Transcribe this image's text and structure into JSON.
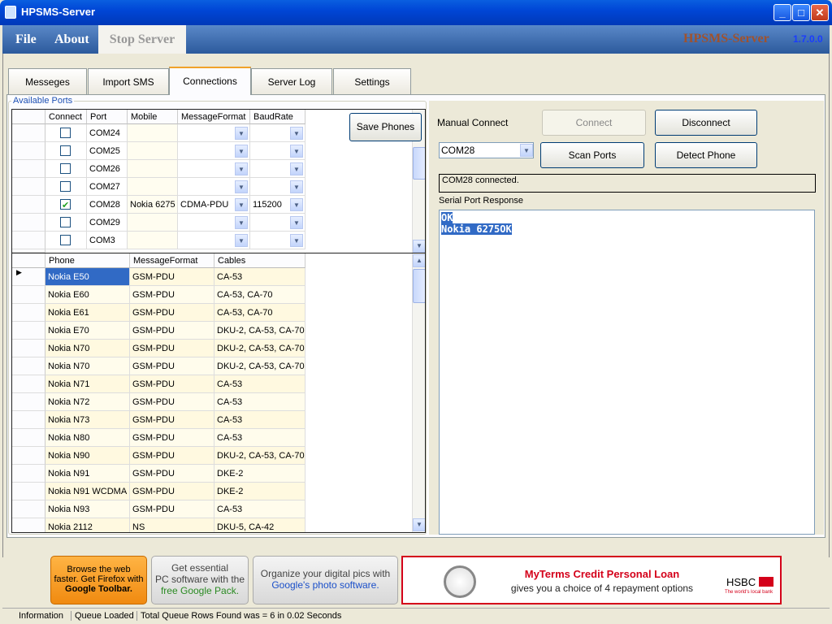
{
  "window": {
    "title": "HPSMS-Server"
  },
  "menu": {
    "file": "File",
    "about": "About",
    "stop": "Stop Server",
    "brand": "HPSMS-Server",
    "version": "1.7.0.0"
  },
  "tabs": [
    "Messeges",
    "Import SMS",
    "Connections",
    "Server Log",
    "Settings"
  ],
  "active_tab": "Connections",
  "ports": {
    "group_label": "Available Ports",
    "columns": [
      "Connect",
      "Port",
      "Mobile",
      "MessageFormat",
      "BaudRate"
    ],
    "rows": [
      {
        "checked": false,
        "port": "COM24",
        "mobile": "",
        "format": "",
        "baud": ""
      },
      {
        "checked": false,
        "port": "COM25",
        "mobile": "",
        "format": "",
        "baud": ""
      },
      {
        "checked": false,
        "port": "COM26",
        "mobile": "",
        "format": "",
        "baud": ""
      },
      {
        "checked": false,
        "port": "COM27",
        "mobile": "",
        "format": "",
        "baud": ""
      },
      {
        "checked": true,
        "port": "COM28",
        "mobile": "Nokia 6275",
        "format": "CDMA-PDU",
        "baud": "115200"
      },
      {
        "checked": false,
        "port": "COM29",
        "mobile": "",
        "format": "",
        "baud": ""
      },
      {
        "checked": false,
        "port": "COM3",
        "mobile": "",
        "format": "",
        "baud": ""
      }
    ],
    "save_label": "Save Phones"
  },
  "phones": {
    "columns": [
      "Phone",
      "MessageFormat",
      "Cables"
    ],
    "rows": [
      [
        "Nokia E50",
        "GSM-PDU",
        "CA-53"
      ],
      [
        "Nokia E60",
        "GSM-PDU",
        "CA-53, CA-70"
      ],
      [
        "Nokia E61",
        "GSM-PDU",
        "CA-53, CA-70"
      ],
      [
        "Nokia E70",
        "GSM-PDU",
        "DKU-2, CA-53, CA-70"
      ],
      [
        "Nokia N70",
        "GSM-PDU",
        "DKU-2, CA-53, CA-70"
      ],
      [
        "Nokia N70",
        "GSM-PDU",
        "DKU-2, CA-53, CA-70"
      ],
      [
        "Nokia N71",
        "GSM-PDU",
        "CA-53"
      ],
      [
        "Nokia N72",
        "GSM-PDU",
        "CA-53"
      ],
      [
        "Nokia N73",
        "GSM-PDU",
        "CA-53"
      ],
      [
        "Nokia N80",
        "GSM-PDU",
        "CA-53"
      ],
      [
        "Nokia N90",
        "GSM-PDU",
        "DKU-2, CA-53, CA-70"
      ],
      [
        "Nokia N91",
        "GSM-PDU",
        "DKE-2"
      ],
      [
        "Nokia N91 WCDMA",
        "GSM-PDU",
        "DKE-2"
      ],
      [
        "Nokia N93",
        "GSM-PDU",
        "CA-53"
      ],
      [
        "Nokia 2112",
        "NS",
        "DKU-5, CA-42"
      ]
    ]
  },
  "manual": {
    "label": "Manual Connect",
    "connect": "Connect",
    "disconnect": "Disconnect",
    "port_value": "COM28",
    "scan": "Scan Ports",
    "detect": "Detect Phone",
    "status": "COM28 connected.",
    "response_label": "Serial Port Response",
    "response_lines": [
      "OK",
      "Nokia 6275OK"
    ]
  },
  "ads": {
    "firefox": [
      "Browse the web",
      "faster. Get Firefox with",
      "Google Toolbar."
    ],
    "pack": [
      "Get essential",
      "PC software with the",
      "free Google Pack."
    ],
    "photo": [
      "Organize your digital pics with",
      "Google's photo software."
    ],
    "hsbc_title": "MyTerms Credit Personal Loan",
    "hsbc_sub": "gives you a choice of 4 repayment options",
    "hsbc_brand": "HSBC",
    "hsbc_tag": "The world's local bank"
  },
  "statusbar": {
    "info": "Information",
    "queue": "Queue Loaded",
    "total": "Total Queue Rows Found was  = 6 in 0.02 Seconds"
  }
}
